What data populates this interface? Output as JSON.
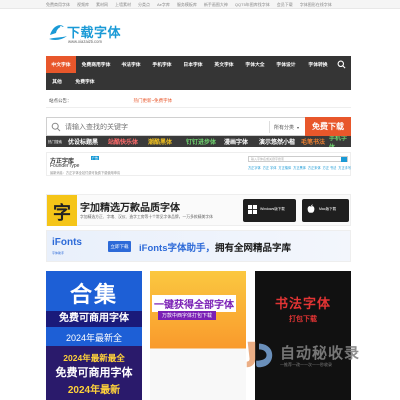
{
  "topbar": {
    "links": [
      "免费商用字体",
      "视频库",
      "素材网",
      "上墙素材",
      "分类点",
      "Ae字库",
      "服务模板库",
      "新手画图大神",
      "QQT5年图库找字体",
      "会员下载",
      "字体图形在线字体"
    ]
  },
  "logo": {
    "title": "下载字体",
    "url": "www.xiazaizti.com"
  },
  "nav": {
    "row1": [
      "中文字体",
      "免费商用字体",
      "书法字体",
      "手机字体",
      "日本字体",
      "英文字体",
      "字体大全",
      "字体设计",
      "字体转换"
    ],
    "row2": [
      "其他",
      "免费字体"
    ]
  },
  "notice": {
    "label": "站点公告：",
    "message": "热门更新~免费字体"
  },
  "search": {
    "placeholder": "请输入查找的关键字",
    "category": "所有分类",
    "button": "免费下载"
  },
  "hot": {
    "label": "热门搜索",
    "items": [
      {
        "text": "优设标题黑",
        "color": "#ffffff"
      },
      {
        "text": "站酷快乐体",
        "color": "#ff6a6a"
      },
      {
        "text": "潮酷黑体",
        "color": "#f0c020"
      },
      {
        "text": "钉钉进步体",
        "color": "#6fd36f"
      },
      {
        "text": "漫画字体",
        "color": "#ffffff"
      },
      {
        "text": "演示悠然小楷",
        "color": "#ffffff"
      },
      {
        "text": "毛笔书法",
        "color": "#f08030"
      },
      {
        "text": "手机字体",
        "color": "#6fd36f"
      }
    ]
  },
  "brand": {
    "name_cn": "方正字库",
    "name_en": "FounderType",
    "badge": "广告",
    "desc": "最新消息：方正字体全站付费可免费下载使用申请",
    "search_placeholder": "输入字体名或关键字搜索",
    "tags": [
      "方正字体",
      "方正 字体",
      "方正楷体",
      "方正黑体",
      "方正宋体",
      "方正 书法",
      "方正手写"
    ]
  },
  "ad1": {
    "icon_letter": "字",
    "title": "字加精选万款品质字体",
    "desc": "字加精选方正、字魂、汉仪、造字工房等十个常见字体品牌，一万多款精美字体",
    "win_label": "Windows版下载",
    "mac_label": "Mac版下载"
  },
  "ad2": {
    "logo": "iFonts",
    "logo_sub": "字体助手",
    "button": "立即下载",
    "text_a": "iFonts字体助手，",
    "text_b": "拥有全网精品字库"
  },
  "tiles": {
    "t1": {
      "title": "合集",
      "sub": "免费可商用字体",
      "year": "2024年最新全",
      "l1": "2024年最新最全",
      "l2": "免费可商用字体",
      "l3": "2024年最新"
    },
    "t2": {
      "title": "一键获得全部字体",
      "sub": "万款中西字体打包下载"
    },
    "t3": {
      "title": "书法字体",
      "sub": "打包下载"
    }
  },
  "watermark": {
    "text": "自动秘收录",
    "sub": "一推荐一改一一次一一秒收录"
  }
}
